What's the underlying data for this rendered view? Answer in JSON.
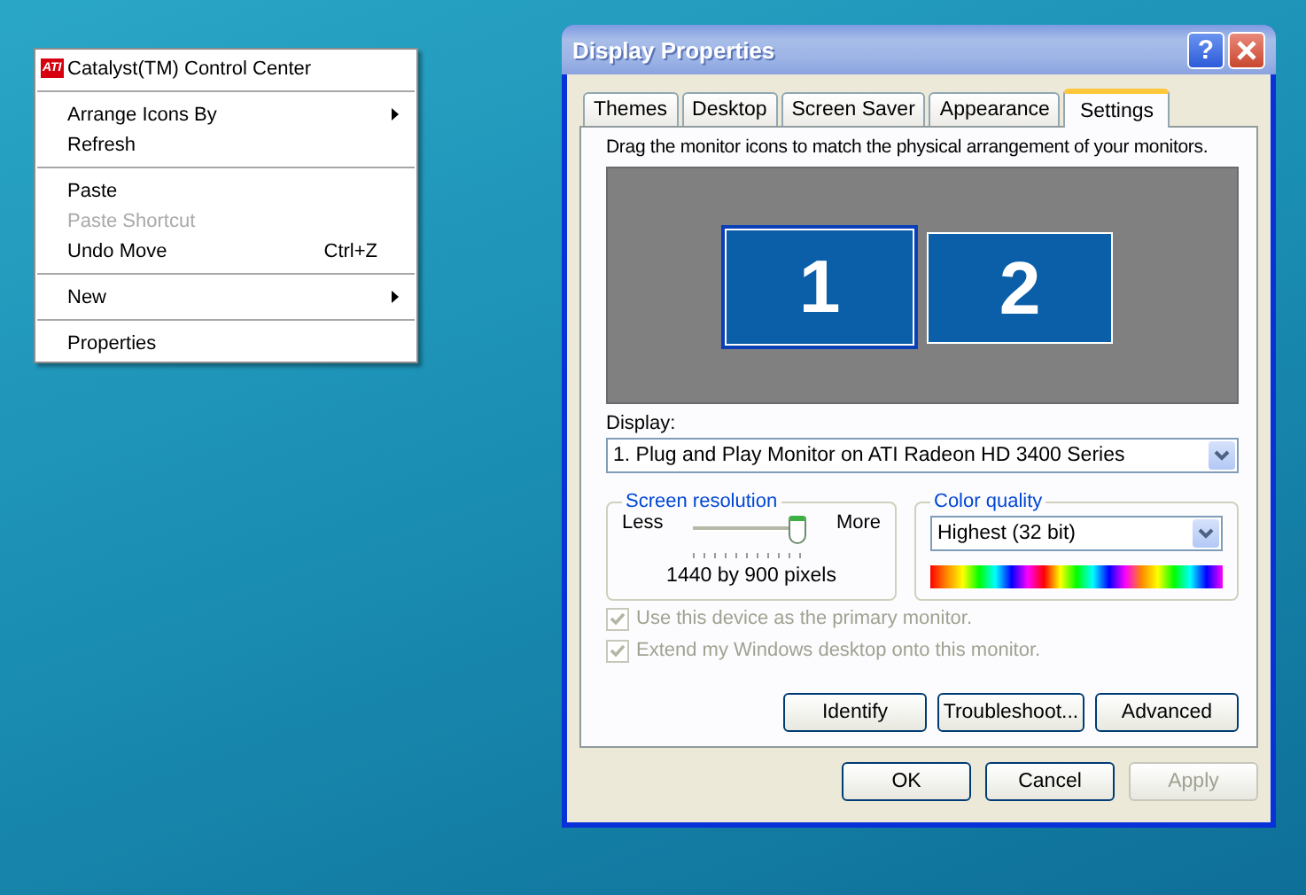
{
  "context_menu": {
    "items": [
      {
        "kind": "item",
        "label": "Catalyst(TM) Control Center",
        "logo": "ATI",
        "submenu": false,
        "disabled": false
      },
      {
        "kind": "separator"
      },
      {
        "kind": "item",
        "label": "Arrange Icons By",
        "submenu": true,
        "disabled": false
      },
      {
        "kind": "item",
        "label": "Refresh",
        "submenu": false,
        "disabled": false
      },
      {
        "kind": "separator"
      },
      {
        "kind": "item",
        "label": "Paste",
        "submenu": false,
        "disabled": false
      },
      {
        "kind": "item",
        "label": "Paste Shortcut",
        "submenu": false,
        "disabled": true
      },
      {
        "kind": "item",
        "label": "Undo Move",
        "shortcut": "Ctrl+Z",
        "submenu": false,
        "disabled": false
      },
      {
        "kind": "separator"
      },
      {
        "kind": "item",
        "label": "New",
        "submenu": true,
        "disabled": false
      },
      {
        "kind": "separator"
      },
      {
        "kind": "item",
        "label": "Properties",
        "submenu": false,
        "disabled": false
      }
    ]
  },
  "dialog": {
    "title": "Display Properties",
    "help_button": "?",
    "tabs": [
      {
        "label": "Themes",
        "selected": false
      },
      {
        "label": "Desktop",
        "selected": false
      },
      {
        "label": "Screen Saver",
        "selected": false
      },
      {
        "label": "Appearance",
        "selected": false
      },
      {
        "label": "Settings",
        "selected": true
      }
    ],
    "instruction": "Drag the monitor icons to match the physical arrangement of your monitors.",
    "monitors": [
      {
        "label": "1",
        "selected": true
      },
      {
        "label": "2",
        "selected": false
      }
    ],
    "display": {
      "label": "Display:",
      "value": "1. Plug and Play Monitor on ATI Radeon HD 3400 Series"
    },
    "screen_resolution": {
      "legend": "Screen resolution",
      "less": "Less",
      "more": "More",
      "level": 0.97,
      "reading": "1440 by 900 pixels"
    },
    "color_quality": {
      "legend": "Color quality",
      "value": "Highest (32 bit)"
    },
    "checkboxes": [
      {
        "label": "Use this device as the primary monitor.",
        "checked": true,
        "disabled": true
      },
      {
        "label": "Extend my Windows desktop onto this monitor.",
        "checked": true,
        "disabled": true
      }
    ],
    "buttons": [
      {
        "label": "Identify",
        "disabled": false
      },
      {
        "label": "Troubleshoot...",
        "disabled": false
      },
      {
        "label": "Advanced",
        "disabled": false
      }
    ],
    "footer_buttons": [
      {
        "label": "OK",
        "disabled": false
      },
      {
        "label": "Cancel",
        "disabled": false
      },
      {
        "label": "Apply",
        "disabled": true
      }
    ]
  }
}
